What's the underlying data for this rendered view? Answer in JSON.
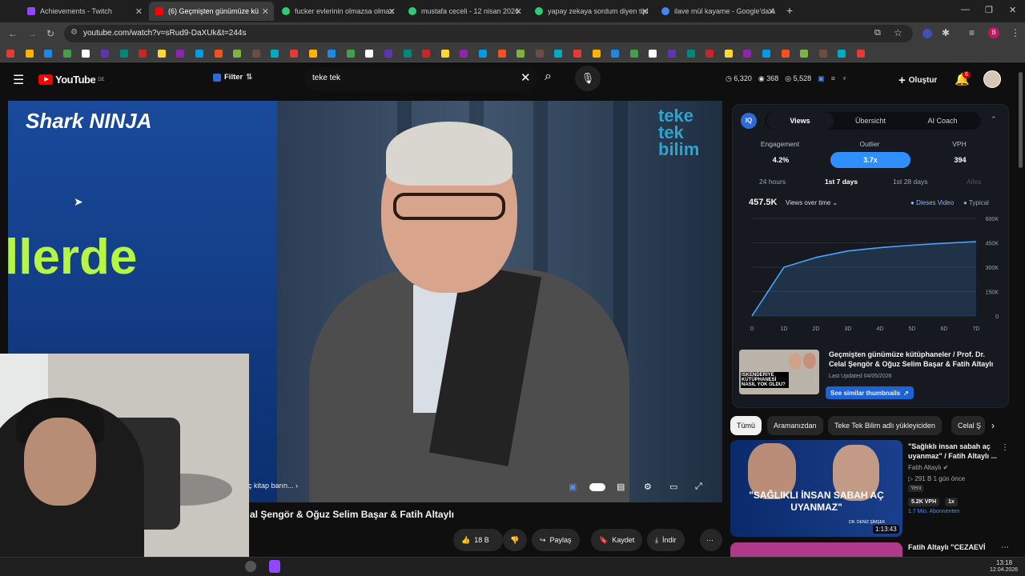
{
  "browser": {
    "tabs": [
      {
        "title": "Achievements - Twitch",
        "color": "#9146ff",
        "active": false
      },
      {
        "title": "(6) Geçmişten günümüze kü",
        "color": "#ff0000",
        "active": true
      },
      {
        "title": "fucker evlerinin olmazsa olmaz",
        "color": "#2ecc71",
        "active": false
      },
      {
        "title": "mustafa ceceli - 12 nisan 2026",
        "color": "#2ecc71",
        "active": false
      },
      {
        "title": "yapay zekaya sordum diyen tipl",
        "color": "#2ecc71",
        "active": false
      },
      {
        "title": "ilave mül kayame - Google'da A",
        "color": "#4285f4",
        "active": false
      }
    ],
    "url": "youtube.com/watch?v=sRud9-DaXUk&t=244s"
  },
  "youtube": {
    "logo_text": "YouTube",
    "region": "DE",
    "filter_label": "Filter",
    "search_value": "teke tek",
    "stats": {
      "views": "6,320",
      "likes": "368",
      "subs": "5,528"
    },
    "create_label": "Oluştur",
    "notif_count": "6"
  },
  "video": {
    "brand_overlay": "Shark NINJA",
    "overlay_text": "llerde",
    "channel_watermark": "teke\ntek\nbilim",
    "chip_text": "ç kitap barın...",
    "title": "al Şengör & Oğuz Selim Başar & Fatih Altaylı",
    "actions": {
      "likes": "18 B",
      "share": "Paylaş",
      "save": "Kaydet",
      "download": "İndir"
    }
  },
  "iq_panel": {
    "badge": "IQ",
    "tabs": [
      "Views",
      "Übersicht",
      "AI Coach"
    ],
    "active_tab": "Views",
    "metrics": [
      {
        "label": "Engagement",
        "value": "4.2%"
      },
      {
        "label": "Outlier",
        "value": "3.7x"
      },
      {
        "label": "VPH",
        "value": "394"
      }
    ],
    "ranges": [
      "24 hours",
      "1st 7 days",
      "1st 28 days",
      "Alles"
    ],
    "active_range": "1st 7 days",
    "total_views": "457.5K",
    "dropdown": "Views over time",
    "legend": [
      "Dieses Video",
      "Typical"
    ],
    "thumb_text": "İSKENDERİYE KÜTÜPHANESİ NASIL YOK OLDU?",
    "related_title": "Geçmişten günümüze kütüphaneler / Prof. Dr. Celal Şengör & Oğuz Selim Başar & Fatih Altaylı",
    "last_updated": "Last Updated 04/05/2026",
    "similar_btn": "See similar thumbnails",
    "colors": {
      "accent": "#2f8fff",
      "series": "#4aa3ff"
    }
  },
  "chart_data": {
    "type": "area",
    "x": [
      0,
      1,
      2,
      3,
      4,
      5,
      6,
      7
    ],
    "x_ticks": [
      "0",
      "1D",
      "2D",
      "3D",
      "4D",
      "5D",
      "6D",
      "7D"
    ],
    "y_ticks": [
      "0",
      "150K",
      "300K",
      "450K",
      "600K"
    ],
    "ylim": [
      0,
      600000
    ],
    "series": [
      {
        "name": "Dieses Video",
        "values": [
          0,
          300000,
          360000,
          400000,
          420000,
          435000,
          447000,
          457500
        ]
      }
    ],
    "grid": true,
    "legend": "top-right"
  },
  "chips": [
    "Tümü",
    "Aramanızdan",
    "Teke Tek Bilim adlı yükleyiciden",
    "Celal Ş"
  ],
  "recommendations": [
    {
      "title": "\"Sağlıklı insan sabah aç uyanmaz\" / Fatih Altaylı ...",
      "channel": "Fatih Altaylı",
      "meta": "291 B  1 gün önce",
      "badge": "Yeni",
      "vph": "5.2K VPH",
      "mult": "1x",
      "subs": "1.7 Mio. Abonnenten",
      "duration": "1:13:43",
      "thumb_text": "\"SAĞLIKLI İNSAN SABAH AÇ UYANMAZ\"",
      "thumb_sub": "DR. DENİZ ŞİMŞEK"
    },
    {
      "title": "Fatih Altaylı \"CEZAEVİ"
    }
  ],
  "taskbar": {
    "time": "13:18",
    "date": "12.04.2026"
  }
}
